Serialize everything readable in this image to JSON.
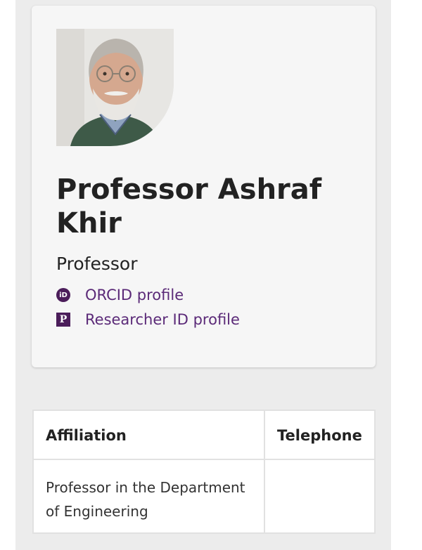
{
  "profile": {
    "photo_icon": "portrait-photo",
    "name": "Professor Ashraf Khir",
    "role": "Professor",
    "links": [
      {
        "icon": "orcid-icon",
        "icon_text": "iD",
        "label": "ORCID profile"
      },
      {
        "icon": "researcher-id-icon",
        "icon_text": "P",
        "label": "Researcher ID profile"
      }
    ]
  },
  "table": {
    "headers": [
      "Affiliation",
      "Telephone"
    ],
    "rows": [
      [
        "Professor in the Department of Engineering",
        ""
      ]
    ]
  },
  "colors": {
    "link": "#5b2a78",
    "icon_bg": "#4b1d5a",
    "card_bg": "#f6f6f6",
    "page_bg": "#ececec"
  }
}
